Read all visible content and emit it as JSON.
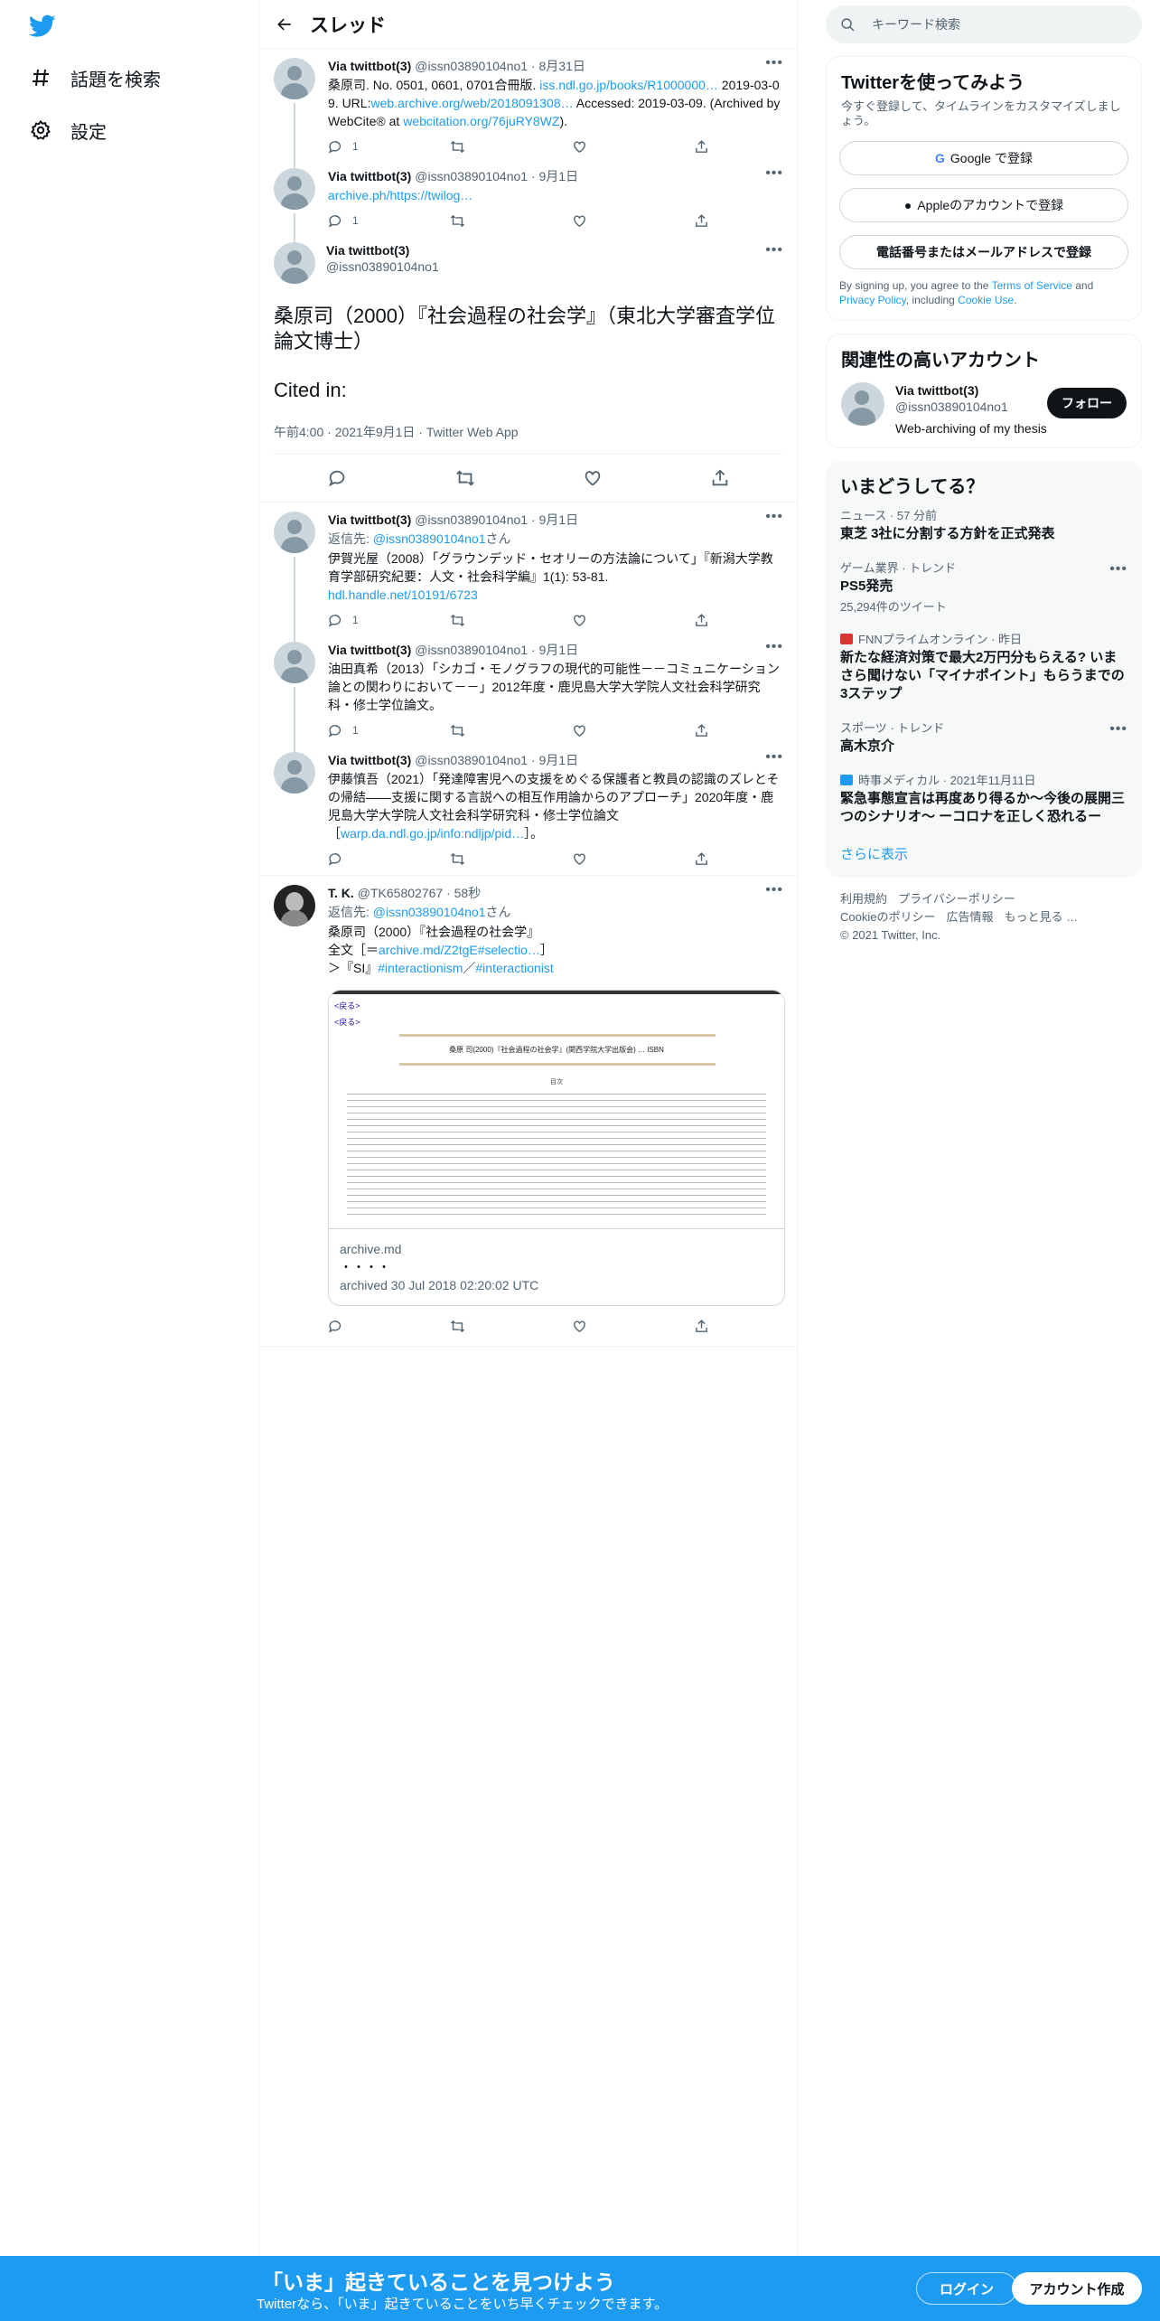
{
  "nav": {
    "explore_label": "話題を検索",
    "settings_label": "設定"
  },
  "header": {
    "title": "スレッド"
  },
  "tweets": [
    {
      "name": "Via twittbot(3)",
      "handle": "@issn03890104no1",
      "date": "8月31日",
      "text_parts": [
        "桑原司. No. 0501, 0601, 0701合冊版. ",
        "iss.ndl.go.jp/books/R1000000…",
        " 2019-03-09. URL:",
        "web.archive.org/web/2018091308…",
        " Accessed: 2019-03-09. (Archived by WebCite® at ",
        "webcitation.org/76juRY8WZ",
        ")."
      ],
      "reply_count": "1"
    },
    {
      "name": "Via twittbot(3)",
      "handle": "@issn03890104no1",
      "date": "9月1日",
      "link": "archive.ph/https://twilog…",
      "reply_count": "1"
    }
  ],
  "focus_tweet": {
    "name": "Via twittbot(3)",
    "handle": "@issn03890104no1",
    "text": "桑原司（2000）『社会過程の社会学』（東北大学審査学位論文博士）",
    "cited": "Cited in:",
    "meta": "午前4:00 · 2021年9月1日 · Twitter Web App"
  },
  "replies": [
    {
      "name": "Via twittbot(3)",
      "handle": "@issn03890104no1",
      "date": "9月1日",
      "reply_to_prefix": "返信先: ",
      "reply_to": "@issn03890104no1",
      "reply_to_suffix": "さん",
      "text": "伊賀光屋（2008）「グラウンデッド・セオリーの方法論について」『新潟大学教育学部研究紀要：人文・社会科学編』1(1): 53-81.",
      "link": "hdl.handle.net/10191/6723",
      "reply_count": "1"
    },
    {
      "name": "Via twittbot(3)",
      "handle": "@issn03890104no1",
      "date": "9月1日",
      "text": "油田真希（2013）「シカゴ・モノグラフの現代的可能性－－コミュニケーション論との関わりにおいて－－」2012年度・鹿児島大学大学院人文社会科学研究科・修士学位論文。",
      "reply_count": "1"
    },
    {
      "name": "Via twittbot(3)",
      "handle": "@issn03890104no1",
      "date": "9月1日",
      "text": "伊藤慎吾（2021）「発達障害児への支援をめぐる保護者と教員の認識のズレとその帰結――支援に関する言説への相互作用論からのアプローチ」2020年度・鹿児島大学大学院人文社会科学研究科・修士学位論文",
      "link_prefix": "［",
      "link": "warp.da.ndl.go.jp/info:ndljp/pid…",
      "link_suffix": "］。",
      "reply_count": ""
    },
    {
      "name": "T. K.",
      "handle": "@TK65802767",
      "date": "58秒",
      "reply_to_prefix": "返信先: ",
      "reply_to": "@issn03890104no1",
      "reply_to_suffix": "さん",
      "line1": "桑原司（2000）『社会過程の社会学』",
      "line2_prefix": "全文［＝",
      "line2_link": "archive.md/Z2tgE#selectio…",
      "line2_suffix": "］",
      "line3_prefix": "＞『SI』",
      "tag1": "#interactionism",
      "tag_sep": "／",
      "tag2": "#interactionist",
      "card_domain": "archive.md",
      "card_title": "・・・・",
      "card_desc": "archived 30 Jul 2018 02:20:02 UTC",
      "card_page": {
        "back": "<戻る>",
        "back2": "<戻る>",
        "heading": "桑原 司(2000)『社会過程の社会学』(関西学院大学出版会) … ISBN",
        "sub": "目次"
      }
    }
  ],
  "search": {
    "placeholder": "キーワード検索"
  },
  "signup": {
    "title": "Twitterを使ってみよう",
    "sub": "今すぐ登録して、タイムラインをカスタマイズしましょう。",
    "google": "Google で登録",
    "apple": "Appleのアカウントで登録",
    "phone": "電話番号またはメールアドレスで登録",
    "legal_1": "By signing up, you agree to the ",
    "terms": "Terms of Service",
    "legal_2": " and ",
    "privacy": "Privacy Policy",
    "legal_3": ", including ",
    "cookie": "Cookie Use",
    "legal_4": "."
  },
  "related": {
    "title": "関連性の高いアカウント",
    "name": "Via twittbot(3)",
    "handle": "@issn03890104no1",
    "bio": "Web-archiving of my thesis",
    "follow": "フォロー"
  },
  "trends": {
    "title": "いまどうしてる？",
    "items": [
      {
        "category": "ニュース · 57 分前",
        "title": "東芝 3社に分割する方針を正式発表",
        "count": ""
      },
      {
        "category": "ゲーム業界 · トレンド",
        "title": "PS5発売",
        "count": "25,294件のツイート"
      },
      {
        "category": "FNNプライムオンライン · 昨日",
        "title": "新たな経済対策で最大2万円分もらえる? いまさら聞けない「マイナポイント」もらうまでの3ステップ",
        "count": ""
      },
      {
        "category": "スポーツ · トレンド",
        "title": "高木京介",
        "count": ""
      },
      {
        "category": "時事メディカル · 2021年11月11日",
        "title": "緊急事態宣言は再度あり得るか～今後の展開三つのシナリオ～ ーコロナを正しく恐れるー",
        "count": ""
      }
    ],
    "show_more": "さらに表示"
  },
  "footer": {
    "terms": "利用規約",
    "privacy": "プライバシーポリシー",
    "cookie": "Cookieのポリシー",
    "ads": "広告情報",
    "more": "もっと見る …",
    "copyright": "© 2021 Twitter, Inc."
  },
  "bottom": {
    "title": "「いま」起きていることを見つけよう",
    "sub": "Twitterなら、「いま」起きていることをいち早くチェックできます。",
    "login": "ログイン",
    "signup": "アカウント作成"
  },
  "colors": {
    "accent": "#1d9bf0",
    "text": "#0f1419",
    "secondary": "#536471"
  }
}
